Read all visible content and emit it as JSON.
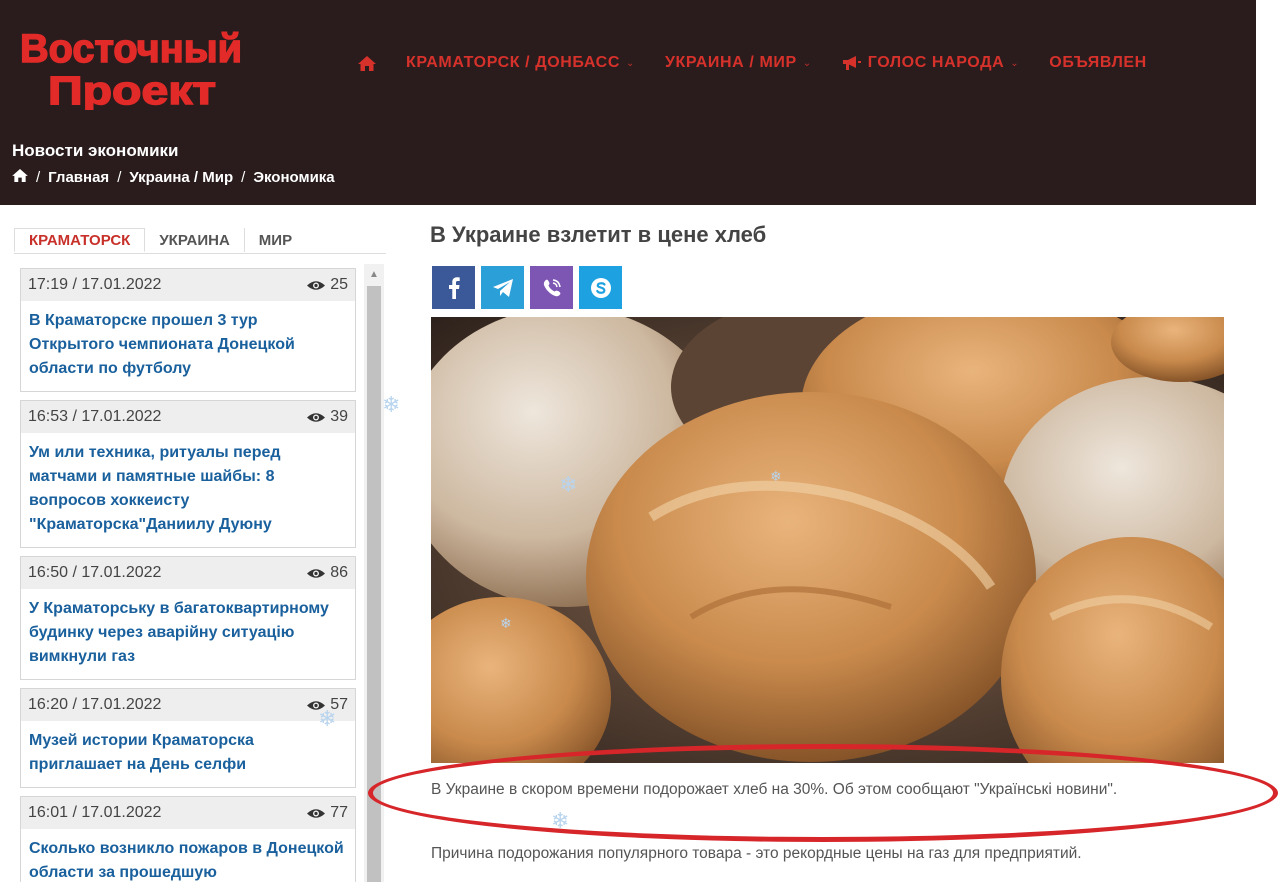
{
  "brand": {
    "line1": "Восточный",
    "line2": "Проект"
  },
  "nav": {
    "home_icon": "home-icon",
    "items": [
      {
        "label": "КРАМАТОРСК / ДОНБАСС",
        "has_dropdown": true
      },
      {
        "label": "УКРАИНА / МИР",
        "has_dropdown": true
      },
      {
        "label": "ГОЛОС НАРОДА",
        "has_dropdown": true,
        "icon": "megaphone-icon"
      },
      {
        "label": "ОБЪЯВЛЕН"
      }
    ]
  },
  "header": {
    "section_title": "Новости экономики",
    "breadcrumb": [
      "Главная",
      "Украина / Мир",
      "Экономика"
    ]
  },
  "sidebar": {
    "tabs": [
      "КРАМАТОРСК",
      "УКРАИНА",
      "МИР"
    ],
    "active_tab": "КРАМАТОРСК",
    "news": [
      {
        "time": "17:19 / 17.01.2022",
        "views": "25",
        "title": "В Краматорске прошел 3 тур Открытого чемпионата Донецкой области по футболу"
      },
      {
        "time": "16:53 / 17.01.2022",
        "views": "39",
        "title": "Ум или техника, ритуалы перед матчами и памятные шайбы: 8 вопросов хоккеисту \"Краматорска\"Даниилу Дуюну"
      },
      {
        "time": "16:50 / 17.01.2022",
        "views": "86",
        "title": "У Краматорську в багатоквартирному будинку через аварійну ситуацію вимкнули газ"
      },
      {
        "time": "16:20 / 17.01.2022",
        "views": "57",
        "title": "Музей истории Краматорска приглашает на День селфи"
      },
      {
        "time": "16:01 / 17.01.2022",
        "views": "77",
        "title": "Сколько возникло пожаров в Донецкой области за прошедшую"
      }
    ]
  },
  "article": {
    "title": "В Украине взлетит в цене хлеб",
    "share": [
      "facebook-icon",
      "telegram-icon",
      "viber-icon",
      "skype-icon"
    ],
    "lead": "В Украине в скором времени подорожает хлеб на 30%. Об этом сообщают \"Українські новини\".",
    "paragraph": "Причина подорожания популярного товара - это рекордные цены на газ для предприятий."
  },
  "colors": {
    "header_bg": "#2a1c1d",
    "brand_red": "#d6312b",
    "link_blue": "#19609d",
    "highlight": "#d7262a"
  }
}
